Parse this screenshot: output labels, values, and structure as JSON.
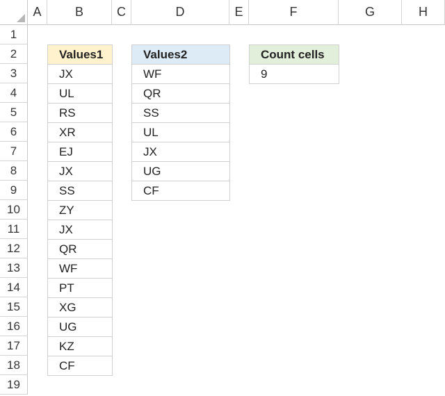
{
  "columns": [
    "A",
    "B",
    "C",
    "D",
    "E",
    "F",
    "G",
    "H"
  ],
  "rows": [
    "1",
    "2",
    "3",
    "4",
    "5",
    "6",
    "7",
    "8",
    "9",
    "10",
    "11",
    "12",
    "13",
    "14",
    "15",
    "16",
    "17",
    "18",
    "19"
  ],
  "tables": {
    "values1": {
      "header": "Values1",
      "header_color": "#fff2cc",
      "items": [
        "JX",
        "UL",
        "RS",
        "XR",
        "EJ",
        "JX",
        "SS",
        "ZY",
        "JX",
        "QR",
        "WF",
        "PT",
        "XG",
        "UG",
        "KZ",
        "CF"
      ]
    },
    "values2": {
      "header": "Values2",
      "header_color": "#ddebf7",
      "items": [
        "WF",
        "QR",
        "SS",
        "UL",
        "JX",
        "UG",
        "CF"
      ]
    },
    "count": {
      "header": "Count cells",
      "header_color": "#e2efda",
      "value": "9"
    }
  }
}
